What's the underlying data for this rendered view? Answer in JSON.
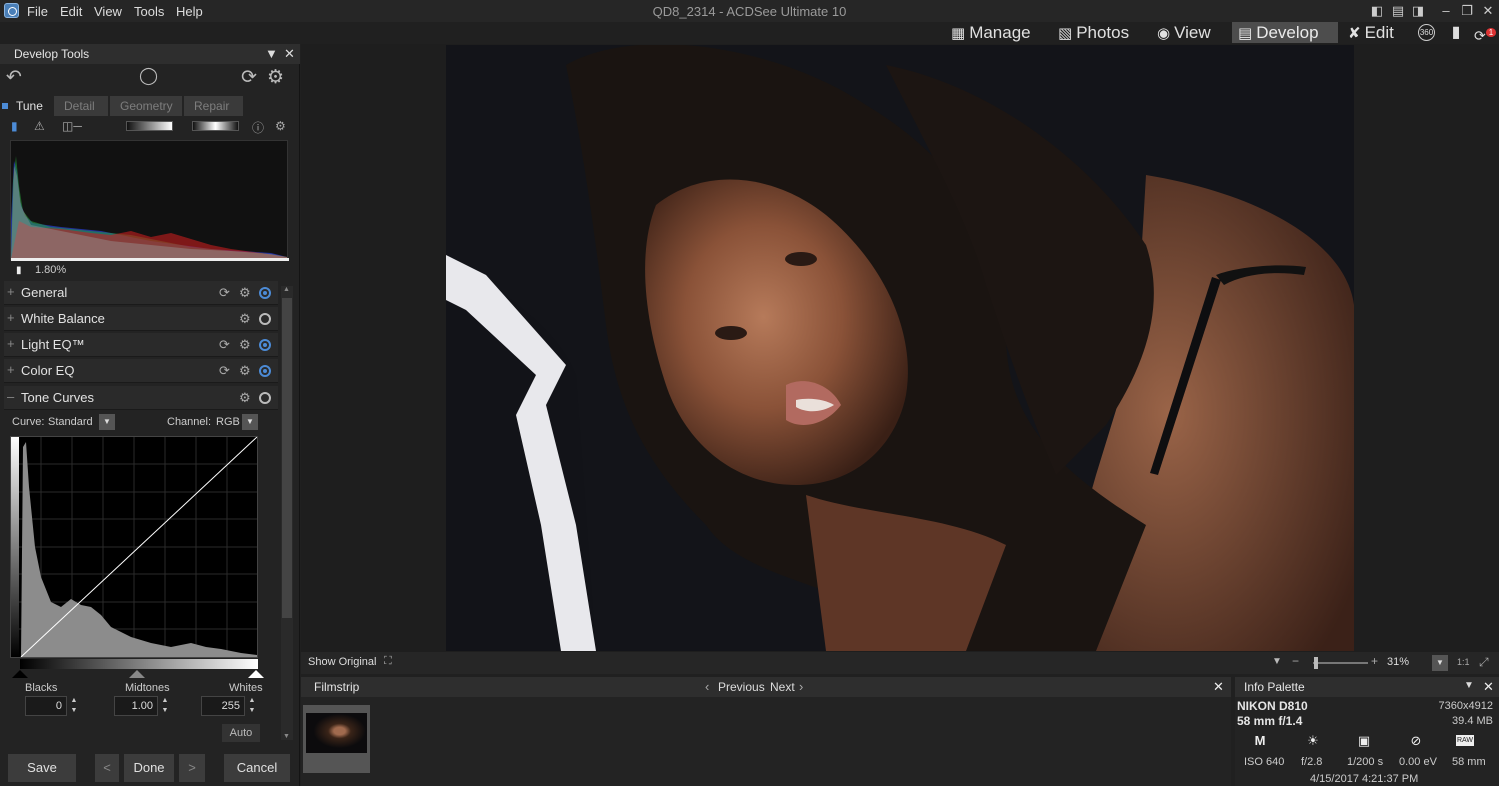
{
  "window": {
    "title": "QD8_2314 - ACDSee Ultimate 10"
  },
  "menu": {
    "file": "File",
    "edit": "Edit",
    "view": "View",
    "tools": "Tools",
    "help": "Help"
  },
  "modes": {
    "manage": "Manage",
    "photos": "Photos",
    "view": "View",
    "develop": "Develop",
    "edit": "Edit",
    "active": "Develop"
  },
  "toolbar_badges": {
    "view360": "360",
    "notification_count": "1"
  },
  "develop_tools": {
    "title": "Develop Tools",
    "tabs": [
      "Tune",
      "Detail",
      "Geometry",
      "Repair"
    ],
    "active_tab": "Tune",
    "clipping_percent": "1.80%",
    "sections": [
      {
        "name": "General",
        "reset": true,
        "enabled": true
      },
      {
        "name": "White Balance",
        "reset": false,
        "enabled": false
      },
      {
        "name": "Light EQ™",
        "reset": true,
        "enabled": true
      },
      {
        "name": "Color EQ",
        "reset": true,
        "enabled": true
      },
      {
        "name": "Tone Curves",
        "reset": false,
        "enabled": false,
        "expanded": true
      }
    ],
    "tone_curves": {
      "curve_label": "Curve:",
      "curve_value": "Standard",
      "channel_label": "Channel:",
      "channel_value": "RGB",
      "blacks_label": "Blacks",
      "blacks": "0",
      "midtones_label": "Midtones",
      "midtones": "1.00",
      "whites_label": "Whites",
      "whites": "255",
      "auto_label": "Auto"
    },
    "buttons": {
      "save": "Save",
      "done": "Done",
      "cancel": "Cancel"
    }
  },
  "status_bar": {
    "show_original": "Show Original",
    "zoom": "31%",
    "actual_size": "1:1"
  },
  "filmstrip": {
    "title": "Filmstrip",
    "previous": "Previous",
    "next": "Next"
  },
  "info_palette": {
    "title": "Info Palette",
    "camera": "NIKON D810",
    "lens": "58 mm f/1.4",
    "dimensions": "7360x4912",
    "file_size": "39.4 MB",
    "mode": "M",
    "raw_badge": "RAW",
    "iso": "ISO 640",
    "aperture": "f/2.8",
    "shutter": "1/200 s",
    "exposure_comp": "0.00 eV",
    "focal_length": "58 mm",
    "date": "4/15/2017 4:21:37 PM"
  }
}
